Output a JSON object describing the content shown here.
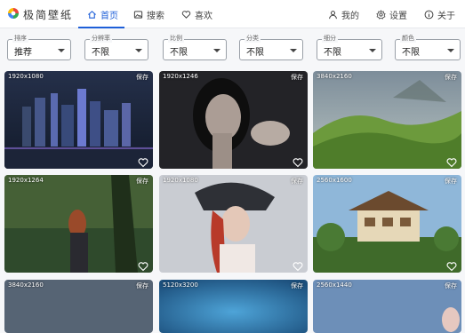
{
  "app": {
    "title": "极简壁纸"
  },
  "nav": {
    "home": "首页",
    "search": "搜索",
    "favorites": "喜欢",
    "mine": "我的",
    "settings": "设置",
    "about": "关于"
  },
  "filters": [
    {
      "label": "排序",
      "value": "推荐"
    },
    {
      "label": "分辨率",
      "value": "不限"
    },
    {
      "label": "比例",
      "value": "不限"
    },
    {
      "label": "分类",
      "value": "不限"
    },
    {
      "label": "细分",
      "value": "不限"
    },
    {
      "label": "颜色",
      "value": "不限"
    }
  ],
  "wallpapers": [
    {
      "resolution": "1920x1080",
      "save": "保存",
      "scene": "futuristic-city-night"
    },
    {
      "resolution": "1920x1246",
      "save": "保存",
      "scene": "dark-haired-girl-portrait"
    },
    {
      "resolution": "3840x2160",
      "save": "保存",
      "scene": "green-valley-landscape"
    },
    {
      "resolution": "1920x1264",
      "save": "保存",
      "scene": "forest-swordswoman"
    },
    {
      "resolution": "1920x1080",
      "save": "保存",
      "scene": "red-haired-pirate-captain"
    },
    {
      "resolution": "2560x1600",
      "save": "保存",
      "scene": "japanese-house-garden"
    },
    {
      "resolution": "3840x2160",
      "save": "保存",
      "scene": "slate-blue"
    },
    {
      "resolution": "5120x3200",
      "save": "保存",
      "scene": "underwater-blue"
    },
    {
      "resolution": "2560x1440",
      "save": "保存",
      "scene": "soft-blue-character"
    }
  ],
  "colors": {
    "accent": "#1e5fd8",
    "nav_bg": "#ffffff",
    "page_bg": "#f6f7f9"
  }
}
